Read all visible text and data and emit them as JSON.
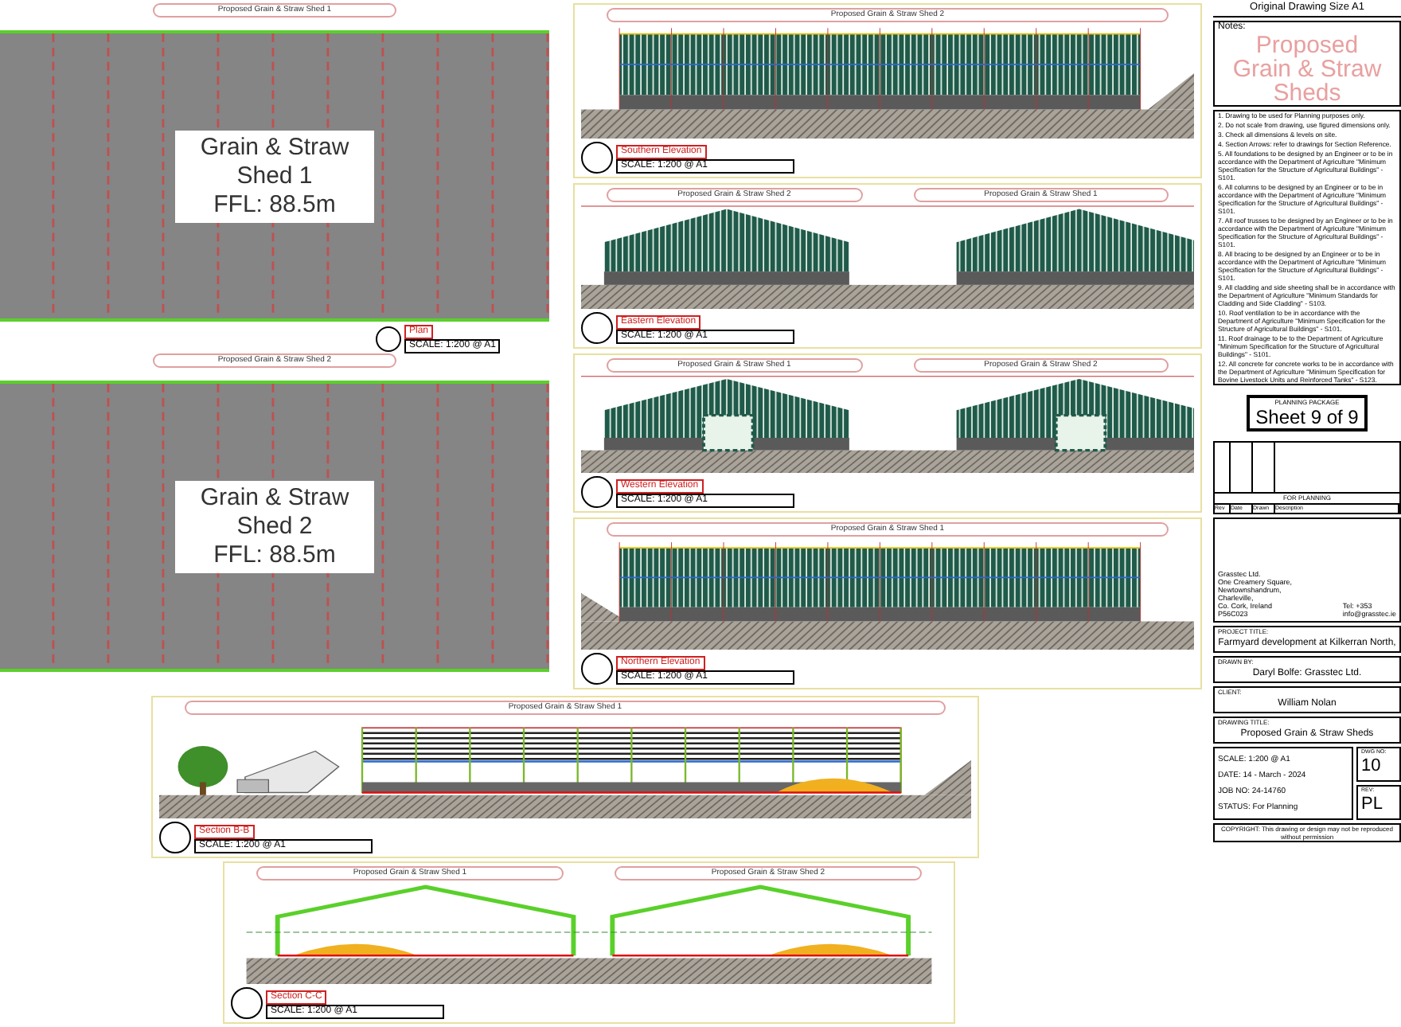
{
  "plans": [
    {
      "title": "Proposed Grain & Straw Shed 1",
      "label_lines": [
        "Grain & Straw",
        "Shed 1",
        "FFL: 88.5m"
      ]
    },
    {
      "title": "Proposed Grain & Straw Shed 2",
      "label_lines": [
        "Grain & Straw",
        "Shed 2",
        "FFL: 88.5m"
      ]
    }
  ],
  "plan_view": {
    "name": "Plan",
    "scale": "SCALE: 1:200 @ A1"
  },
  "views": [
    {
      "kind": "long_bank_right",
      "name": "Southern Elevation",
      "scale": "SCALE: 1:200 @ A1",
      "titles": [
        "Proposed Grain & Straw Shed 2"
      ]
    },
    {
      "kind": "gable",
      "door": false,
      "name": "Eastern Elevation",
      "scale": "SCALE: 1:200 @ A1",
      "titles": [
        "Proposed Grain & Straw Shed 2",
        "Proposed Grain & Straw Shed 1"
      ]
    },
    {
      "kind": "gable",
      "door": true,
      "name": "Western Elevation",
      "scale": "SCALE: 1:200 @ A1",
      "titles": [
        "Proposed Grain & Straw Shed 1",
        "Proposed Grain & Straw Shed 2"
      ]
    },
    {
      "kind": "long_bank_left",
      "name": "Northern Elevation",
      "scale": "SCALE: 1:200 @ A1",
      "titles": [
        "Proposed Grain & Straw Shed 1"
      ]
    },
    {
      "kind": "section_long",
      "name": "Section B-B",
      "scale": "SCALE: 1:200 @ A1",
      "titles": [
        "Proposed Grain & Straw Shed 1"
      ]
    },
    {
      "kind": "section_gable",
      "name": "Section C-C",
      "scale": "SCALE: 1:200 @ A1",
      "titles": [
        "Proposed Grain & Straw Shed 1",
        "Proposed Grain & Straw Shed 2"
      ]
    }
  ],
  "sheet": {
    "original_size": "Original Drawing Size A1",
    "notes_label": "Notes:",
    "title_lines": [
      "Proposed",
      "Grain & Straw",
      "Sheds"
    ],
    "notes": [
      "1. Drawing to be used for Planning purposes only.",
      "2. Do not scale from drawing, use figured dimensions only.",
      "3. Check all dimensions & levels on site.",
      "4. Section Arrows: refer to drawings for Section Reference.",
      "5. All foundations to be designed by an Engineer or to be in accordance with the Department of Agriculture \"Minimum Specification for the Structure of Agricultural Buildings\" - S101.",
      "6. All columns to be designed by an Engineer or to be in accordance with the Department of Agriculture \"Minimum Specification for the Structure of Agricultural Buildings\" - S101.",
      "7. All roof trusses to be designed by an Engineer or to be in accordance with the Department of Agriculture \"Minimum Specification for the Structure of Agricultural Buildings\" - S101.",
      "8. All bracing to be designed by an Engineer or to be in accordance with the Department of Agriculture \"Minimum Specification for the Structure of Agricultural Buildings\" - S101.",
      "9. All cladding and side sheeting shall be in accordance with the Department of Agriculture \"Minimum Standards for Cladding and Side Cladding\" - S103.",
      "10. Roof ventilation to be in accordance with the Department of Agriculture \"Minimum Specification for the Structure of Agricultural Buildings\" - S101.",
      "11. Roof drainage to be to the Department of Agriculture \"Minimum Specification for the Structure of Agricultural Buildings\" - S101.",
      "12. All concrete for concrete works to be in accordance with the Department of Agriculture \"Minimum Specification for Bovine Livestock Units and Reinforced Tanks\" - S123."
    ],
    "package_label": "PLANNING PACKAGE",
    "sheet_number": "Sheet 9 of 9",
    "revision_heading": "FOR PLANNING",
    "revision_columns": [
      "Rev",
      "Date",
      "Drawn",
      "Description"
    ],
    "company_lines": [
      "Grasstec Ltd.",
      "One Creamery Square,",
      "Newtownshandrum,",
      "Charleville,",
      "Co. Cork, Ireland",
      "P56C023"
    ],
    "contact_lines": [
      "Tel: +353",
      "info@grasstec.ie"
    ],
    "fields": [
      {
        "label": "PROJECT TITLE:",
        "value": "Farmyard development at Kilkerran North,"
      },
      {
        "label": "DRAWN BY:",
        "value": "Daryl Bolfe: Grasstec Ltd."
      },
      {
        "label": "CLIENT:",
        "value": "William Nolan"
      },
      {
        "label": "DRAWING TITLE:",
        "value": "Proposed Grain & Straw Sheds"
      }
    ],
    "details": [
      {
        "label": "SCALE:",
        "value": "1:200 @ A1"
      },
      {
        "label": "DATE:",
        "value": "14 - March - 2024"
      },
      {
        "label": "JOB NO:",
        "value": "24-14760"
      },
      {
        "label": "STATUS:",
        "value": "For Planning"
      }
    ],
    "dwg_label": "DWG NO:",
    "dwg_no": "10",
    "rev_label": "REV:",
    "rev": "PL",
    "copyright": "COPYRIGHT: This drawing or design may not be reproduced without permission"
  }
}
